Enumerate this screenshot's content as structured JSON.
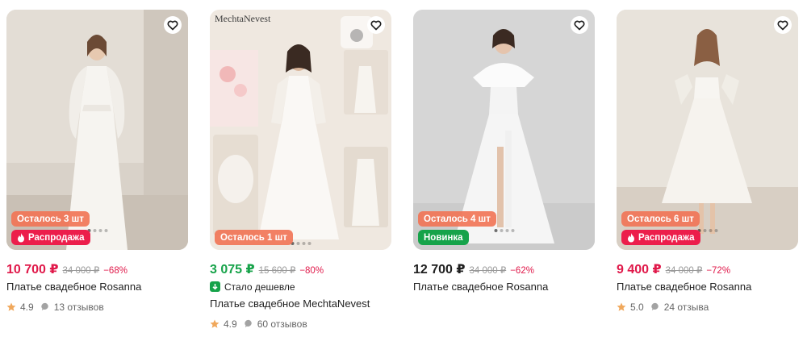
{
  "products": [
    {
      "stock_badge": "Осталось 3 шт",
      "label_badge": "Распродажа",
      "price": "10 700 ₽",
      "old_price": "34 000 ₽",
      "discount": "−68%",
      "title": "Платье свадебное Rosanna",
      "rating": "4.9",
      "reviews": "13 отзывов"
    },
    {
      "brand_overlay": "MechtaNevest",
      "stock_badge": "Осталось 1 шт",
      "price": "3 075 ₽",
      "old_price": "15 600 ₽",
      "discount": "−80%",
      "promo": "Стало дешевле",
      "title": "Платье свадебное MechtaNevest",
      "rating": "4.9",
      "reviews": "60 отзывов"
    },
    {
      "stock_badge": "Осталось 4 шт",
      "label_badge": "Новинка",
      "price": "12 700 ₽",
      "old_price": "34 000 ₽",
      "discount": "−62%",
      "title": "Платье свадебное Rosanna"
    },
    {
      "stock_badge": "Осталось 6 шт",
      "label_badge": "Распродажа",
      "price": "9 400 ₽",
      "old_price": "34 000 ₽",
      "discount": "−72%",
      "title": "Платье свадебное Rosanna",
      "rating": "5.0",
      "reviews": "24 отзыва"
    }
  ],
  "icons": {
    "favorite": "heart-outline-icon",
    "sale": "fire-icon",
    "promo": "price-down-icon",
    "rating": "star-icon",
    "reviews": "chat-bubble-icon"
  },
  "colors": {
    "sale_price": "#e0194a",
    "promo_price": "#17a34a",
    "stock_badge": "#f17557",
    "sale_badge": "#ec1e4b",
    "new_badge": "#16a34a",
    "star": "#f0a85c"
  }
}
